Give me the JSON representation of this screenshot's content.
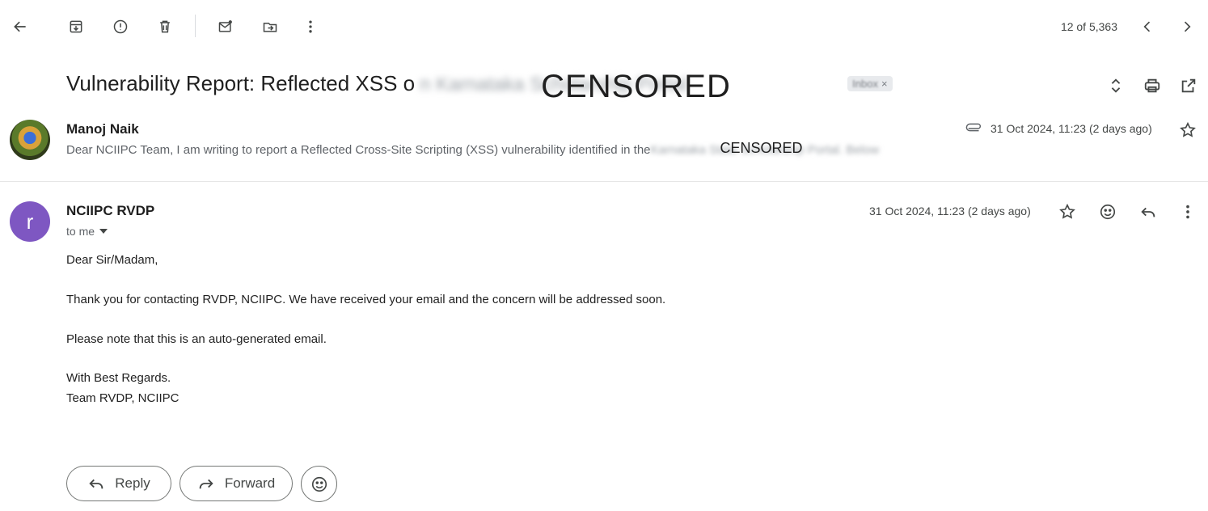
{
  "toolbar": {
    "icons": [
      "back-arrow-icon",
      "archive-icon",
      "report-spam-icon",
      "delete-icon",
      "mark-unread-icon",
      "move-to-icon",
      "more-vertical-icon"
    ],
    "pager": "12 of 5,363",
    "older_icon": "chevron-left-icon",
    "newer_icon": "chevron-right-icon"
  },
  "subject": {
    "text": "Vulnerability Report: Reflected XSS o",
    "blurred_text": "n Karnataka Scholarship Portal",
    "censor_overlay": "CENSORED",
    "label": "Inbox",
    "label_close": "×"
  },
  "message1": {
    "sender": "Manoj Naik",
    "snippet": "Dear NCIIPC Team, I am writing to report a Reflected Cross-Site Scripting (XSS) vulnerability identified in the",
    "snippet_blurred": " Karnataka State Scholarship Portal. Below",
    "censor_overlay": "CENSORED",
    "date": "31 Oct 2024, 11:23 (2 days ago)"
  },
  "message2": {
    "avatar_letter": "r",
    "sender": "NCIIPC RVDP",
    "to": "to me",
    "date": "31 Oct 2024, 11:23 (2 days ago)",
    "body": {
      "greeting": "Dear Sir/Madam,",
      "line1": "Thank you for contacting RVDP, NCIIPC. We have received your email and the concern will be addressed soon.",
      "line2": "Please note that this is an auto-generated email.",
      "signoff": "With Best Regards.",
      "signature": "Team RVDP, NCIIPC"
    }
  },
  "actions": {
    "reply_label": "Reply",
    "forward_label": "Forward"
  },
  "colors": {
    "avatar_purple": "#7e57c2",
    "icon_gray": "#444746",
    "text_dark": "#1f1f1f"
  }
}
